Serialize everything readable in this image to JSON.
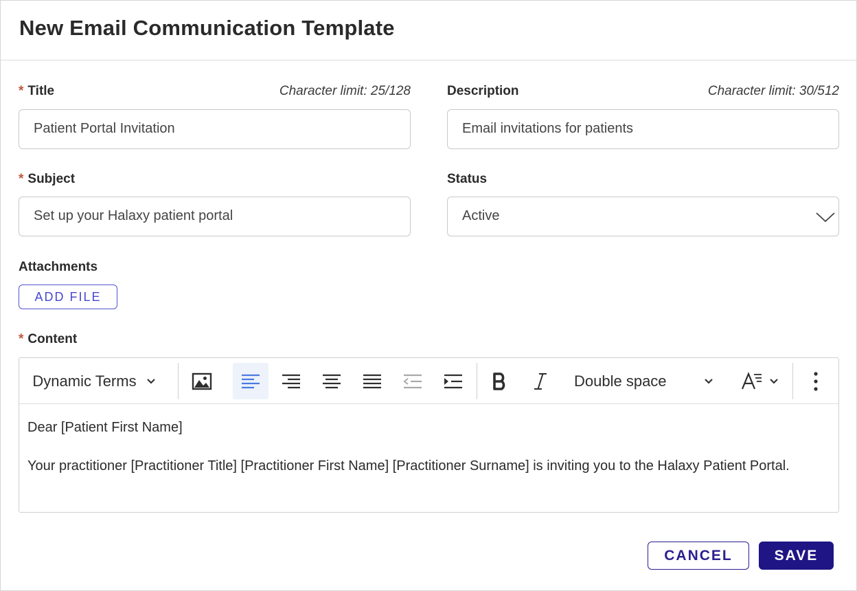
{
  "dialog": {
    "title": "New Email Communication Template"
  },
  "form": {
    "title": {
      "label": "Title",
      "required_mark": "*",
      "char_limit": "Character limit: 25/128",
      "value": "Patient Portal Invitation"
    },
    "description": {
      "label": "Description",
      "char_limit": "Character limit: 30/512",
      "value": "Email invitations for patients"
    },
    "subject": {
      "label": "Subject",
      "required_mark": "*",
      "value": "Set up your Halaxy patient portal"
    },
    "status": {
      "label": "Status",
      "value": "Active",
      "icon": "chevron-down-icon"
    },
    "attachments": {
      "label": "Attachments",
      "add_file_label": "ADD FILE"
    },
    "content": {
      "label": "Content",
      "required_mark": "*"
    }
  },
  "toolbar": {
    "dynamic_terms_label": "Dynamic Terms",
    "line_spacing_label": "Double space",
    "icons": [
      "image-icon",
      "align-left-icon",
      "align-right-icon",
      "align-center-icon",
      "align-justify-icon",
      "outdent-icon",
      "indent-icon",
      "bold-icon",
      "italic-icon",
      "font-size-icon",
      "more-vertical-icon"
    ],
    "active_color": "#4a7be0"
  },
  "editor_content": {
    "paragraph_1": "Dear [Patient First Name]",
    "paragraph_2": "Your practitioner [Practitioner Title] [Practitioner First Name] [Practitioner Surname] is inviting you to the Halaxy Patient Portal."
  },
  "actions": {
    "cancel_label": "CANCEL",
    "save_label": "SAVE"
  },
  "colors": {
    "required": "#c0563f",
    "primary": "#1f1585",
    "add_file": "#4848cf"
  }
}
